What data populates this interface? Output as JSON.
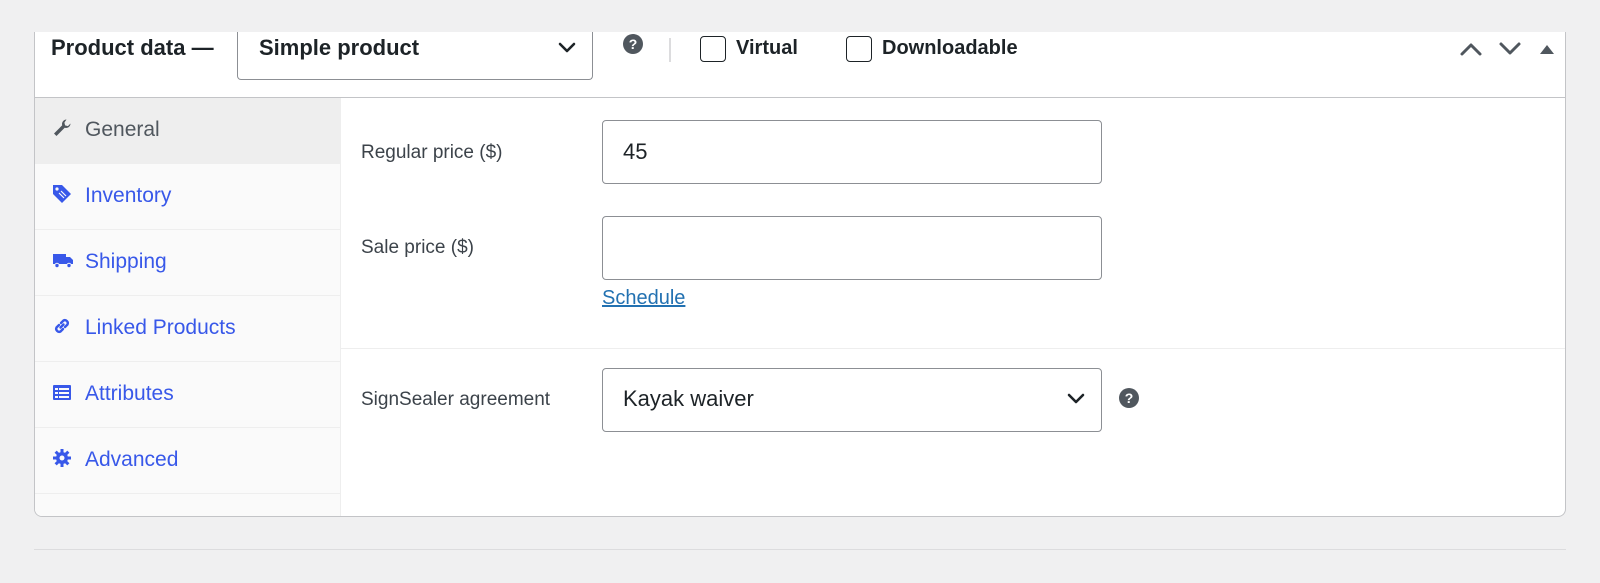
{
  "header": {
    "title": "Product data —",
    "product_type": "Simple product",
    "virtual_label": "Virtual",
    "downloadable_label": "Downloadable"
  },
  "tabs": [
    {
      "label": "General",
      "icon": "wrench-icon",
      "active": true
    },
    {
      "label": "Inventory",
      "icon": "tag-icon",
      "active": false
    },
    {
      "label": "Shipping",
      "icon": "truck-icon",
      "active": false
    },
    {
      "label": "Linked Products",
      "icon": "link-icon",
      "active": false
    },
    {
      "label": "Attributes",
      "icon": "list-icon",
      "active": false
    },
    {
      "label": "Advanced",
      "icon": "gear-icon",
      "active": false
    }
  ],
  "general": {
    "regular_price_label": "Regular price ($)",
    "regular_price_value": "45",
    "sale_price_label": "Sale price ($)",
    "sale_price_value": "",
    "schedule_link": "Schedule",
    "signsealer_label": "SignSealer agreement",
    "signsealer_value": "Kayak waiver"
  },
  "colors": {
    "link": "#3858e9",
    "tab_active_bg": "#eeeeee",
    "panel_bg": "#ffffff",
    "page_bg": "#f0f0f1"
  }
}
